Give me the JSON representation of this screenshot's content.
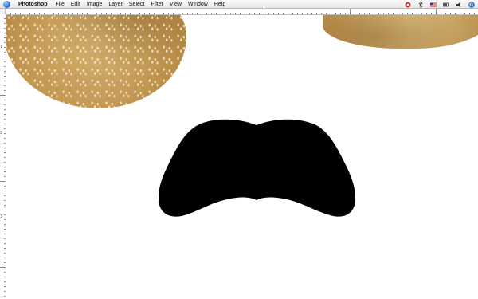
{
  "menubar": {
    "app_name": "Photoshop",
    "items": [
      "File",
      "Edit",
      "Image",
      "Layer",
      "Select",
      "Filter",
      "View",
      "Window",
      "Help"
    ],
    "status_icons": [
      "airport-icon",
      "bluetooth-icon",
      "flag-us-icon",
      "battery-icon",
      "volume-icon",
      "spotlight-icon"
    ]
  },
  "canvas": {
    "rulers": {
      "left_labels": [
        "1",
        "2",
        "3"
      ]
    },
    "layers": [
      "bread-left-image",
      "bread-right-image",
      "black-mustache-shape"
    ]
  },
  "colors": {
    "shape_fill": "#000000",
    "canvas_bg": "#ffffff",
    "accent_blue": "#1b64c8"
  }
}
